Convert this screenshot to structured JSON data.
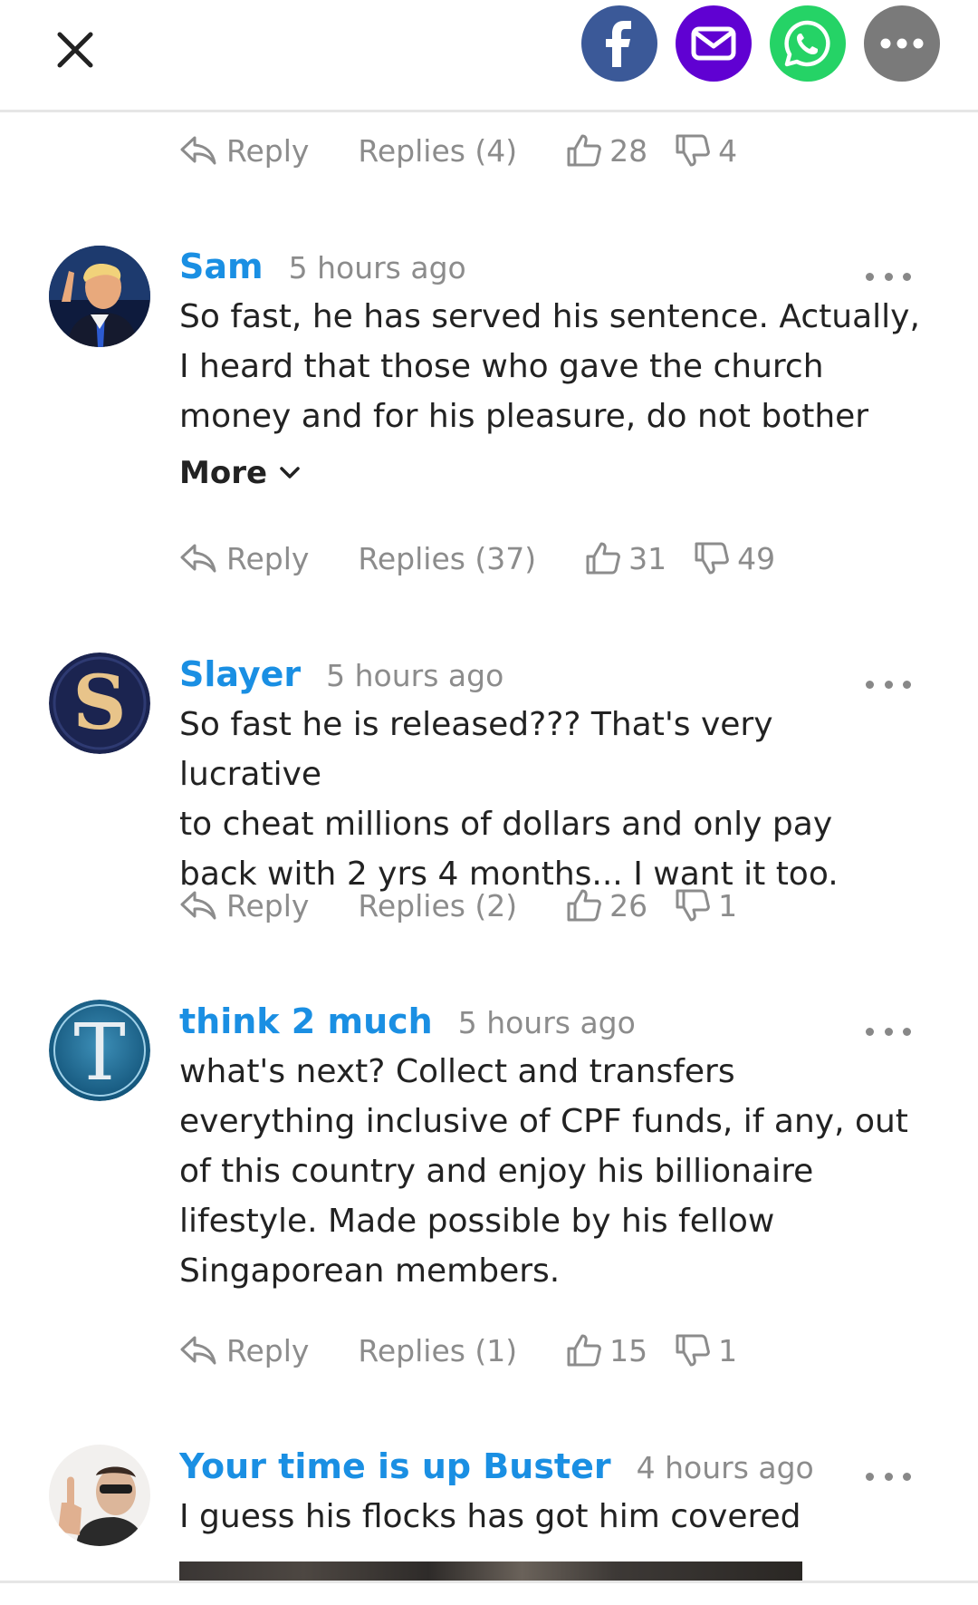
{
  "header": {
    "share_colors": {
      "facebook": "#3b5998",
      "email": "#6001d2",
      "whatsapp": "#25d366",
      "more": "#7a7a7a"
    }
  },
  "top_actions": {
    "reply": "Reply",
    "replies": "Replies (4)",
    "likes": "28",
    "dislikes": "4"
  },
  "comments": [
    {
      "author": "Sam",
      "time": "5 hours ago",
      "lines": [
        "So fast, he has served his sentence. Actually,",
        "I heard that those who gave the church",
        "money and for his pleasure, do not bother"
      ],
      "more": "More",
      "reply": "Reply",
      "replies": "Replies (37)",
      "likes": "31",
      "dislikes": "49"
    },
    {
      "author": "Slayer",
      "time": "5 hours ago",
      "lines": [
        "So fast he is released??? That's very lucrative",
        "to cheat millions of dollars and only pay",
        "back with 2 yrs 4 months... I want it too."
      ],
      "reply": "Reply",
      "replies": "Replies (2)",
      "likes": "26",
      "dislikes": "1"
    },
    {
      "author": "think 2 much",
      "time": "5 hours ago",
      "lines": [
        "what's next? Collect and transfers",
        "everything inclusive of CPF funds, if any, out",
        "of this country and enjoy his billionaire",
        "lifestyle. Made possible by his fellow",
        "Singaporean members."
      ],
      "reply": "Reply",
      "replies": "Replies (1)",
      "likes": "15",
      "dislikes": "1"
    },
    {
      "author": "Your time is up Buster",
      "time": "4 hours ago",
      "lines": [
        "I guess his flocks has got him covered"
      ]
    }
  ],
  "avatar_letters": {
    "slayer": "S",
    "think": "T"
  },
  "accent_colors": {
    "author_link": "#1a8fe3",
    "meta_gray": "#8c8c8c"
  }
}
